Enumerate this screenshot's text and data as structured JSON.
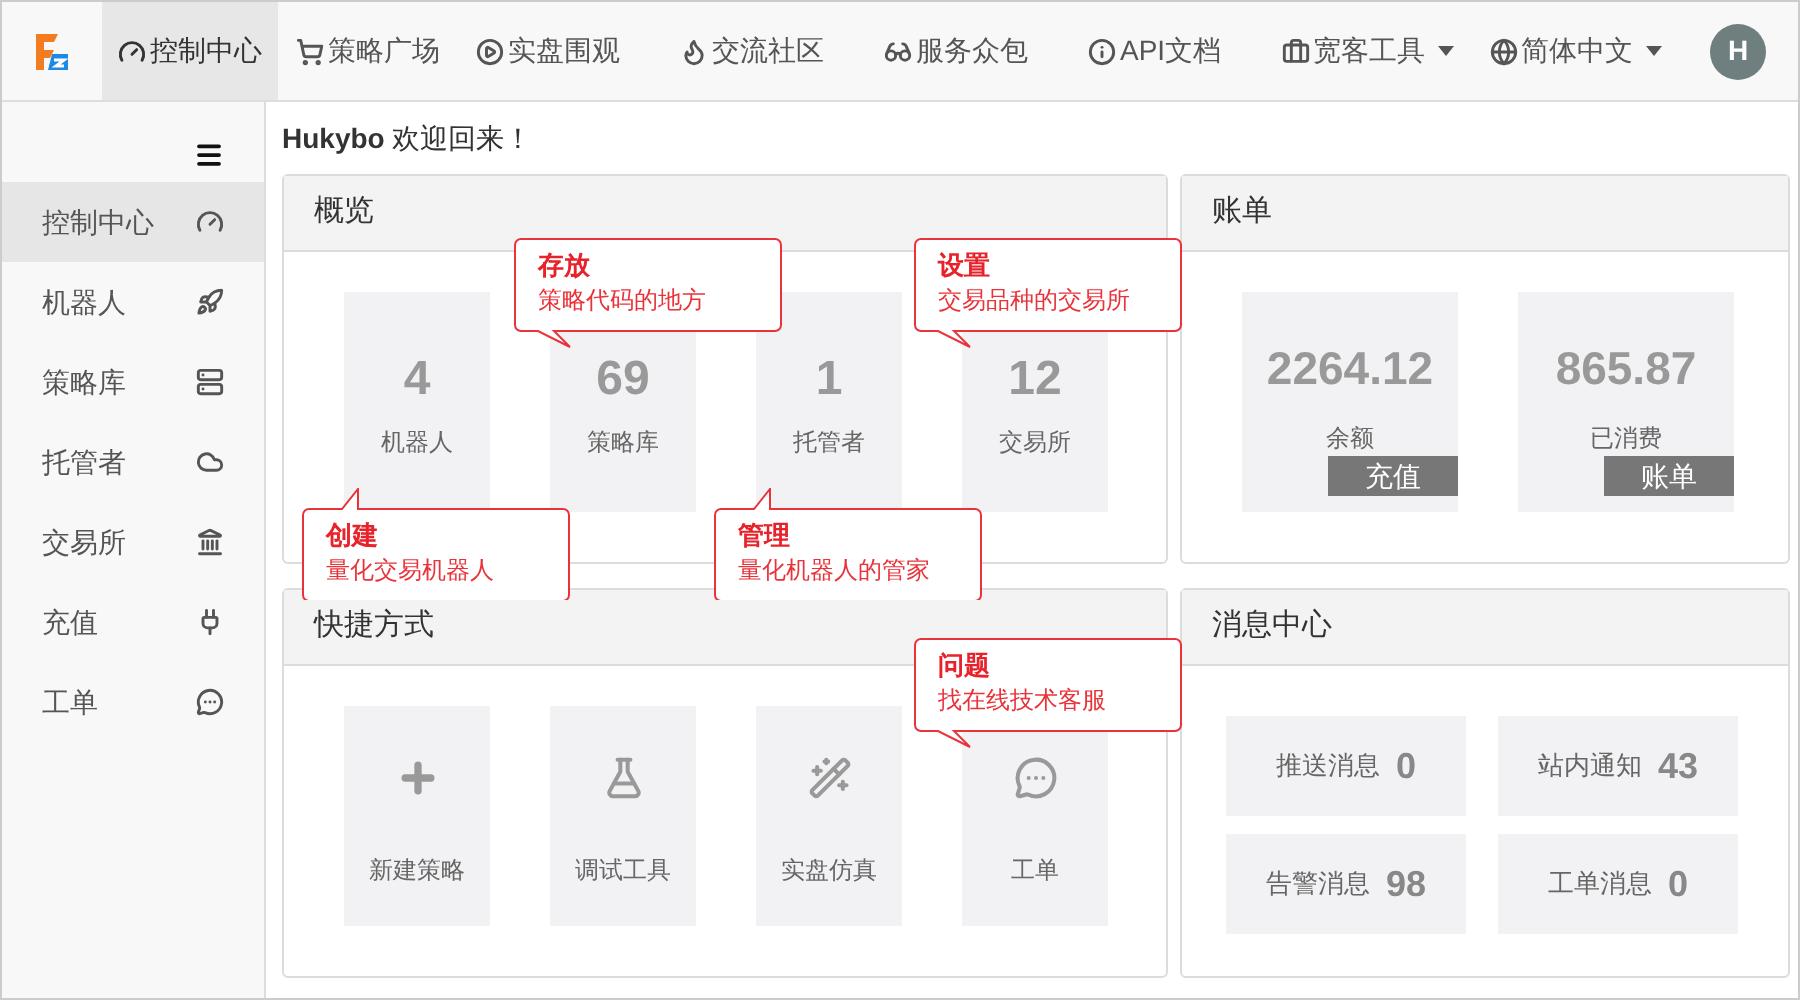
{
  "nav": {
    "items": [
      {
        "label": "控制中心",
        "selected": true,
        "dropdown": false
      },
      {
        "label": "策略广场",
        "selected": false,
        "dropdown": false
      },
      {
        "label": "实盘围观",
        "selected": false,
        "dropdown": false
      },
      {
        "label": "交流社区",
        "selected": false,
        "dropdown": false
      },
      {
        "label": "服务众包",
        "selected": false,
        "dropdown": false
      },
      {
        "label": "API文档",
        "selected": false,
        "dropdown": false
      },
      {
        "label": "宽客工具",
        "selected": false,
        "dropdown": true
      },
      {
        "label": "简体中文",
        "selected": false,
        "dropdown": true
      }
    ],
    "avatar": "H"
  },
  "sidebar": {
    "items": [
      {
        "label": "控制中心",
        "selected": true
      },
      {
        "label": "机器人",
        "selected": false
      },
      {
        "label": "策略库",
        "selected": false
      },
      {
        "label": "托管者",
        "selected": false
      },
      {
        "label": "交易所",
        "selected": false
      },
      {
        "label": "充值",
        "selected": false
      },
      {
        "label": "工单",
        "selected": false
      }
    ]
  },
  "welcome": "**Hukybo** 欢迎回来！",
  "overview": {
    "title": "概览",
    "tiles": [
      {
        "value": "4",
        "label": "机器人"
      },
      {
        "value": "69",
        "label": "策略库"
      },
      {
        "value": "1",
        "label": "托管者"
      },
      {
        "value": "12",
        "label": "交易所"
      }
    ]
  },
  "bill": {
    "title": "账单",
    "tiles": [
      {
        "value": "2264.12",
        "label": "余额",
        "button": "充值"
      },
      {
        "value": "865.87",
        "label": "已消费",
        "button": "账单"
      }
    ]
  },
  "shortcuts": {
    "title": "快捷方式",
    "tiles": [
      {
        "label": "新建策略"
      },
      {
        "label": "调试工具"
      },
      {
        "label": "实盘仿真"
      },
      {
        "label": "工单"
      }
    ]
  },
  "messages": {
    "title": "消息中心",
    "tiles": [
      {
        "label": "推送消息",
        "count": "0"
      },
      {
        "label": "站内通知",
        "count": "43"
      },
      {
        "label": "告警消息",
        "count": "98"
      },
      {
        "label": "工单消息",
        "count": "0"
      }
    ]
  },
  "callouts": [
    {
      "title": "存放",
      "text": "策略代码的地方"
    },
    {
      "title": "设置",
      "text": "交易品种的交易所"
    },
    {
      "title": "创建",
      "text": "量化交易机器人"
    },
    {
      "title": "管理",
      "text": "量化机器人的管家"
    },
    {
      "title": "问题",
      "text": "找在线技术客服"
    }
  ]
}
